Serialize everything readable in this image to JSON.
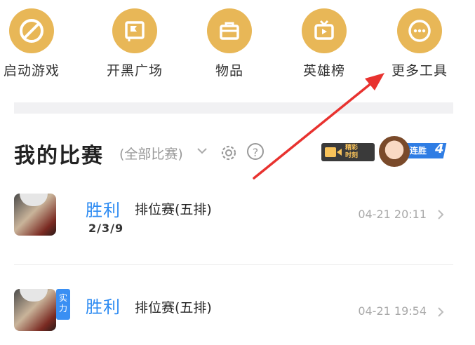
{
  "tools": [
    {
      "label": "启动游戏",
      "icon": "launch-game-icon"
    },
    {
      "label": "开黑广场",
      "icon": "team-plaza-icon"
    },
    {
      "label": "物品",
      "icon": "items-icon"
    },
    {
      "label": "英雄榜",
      "icon": "hero-ranking-icon"
    },
    {
      "label": "更多工具",
      "icon": "more-tools-icon"
    }
  ],
  "section": {
    "title": "我的比赛",
    "filter": "(全部比赛)",
    "help": "?"
  },
  "badges": {
    "highlight_line1": "精彩",
    "highlight_line2": "时刻",
    "streak_label": "连胜",
    "streak_count": "4"
  },
  "matches": [
    {
      "result": "胜利",
      "mode": "排位赛(五排)",
      "kda": "2/3/9",
      "time": "04-21 20:11"
    },
    {
      "result": "胜利",
      "mode": "排位赛(五排)",
      "kda": "",
      "time": "04-21 19:54",
      "badge": "实力"
    }
  ],
  "colors": {
    "accent": "#e8b757",
    "win": "#2d8bf2",
    "annotation_arrow": "#e8322f"
  }
}
